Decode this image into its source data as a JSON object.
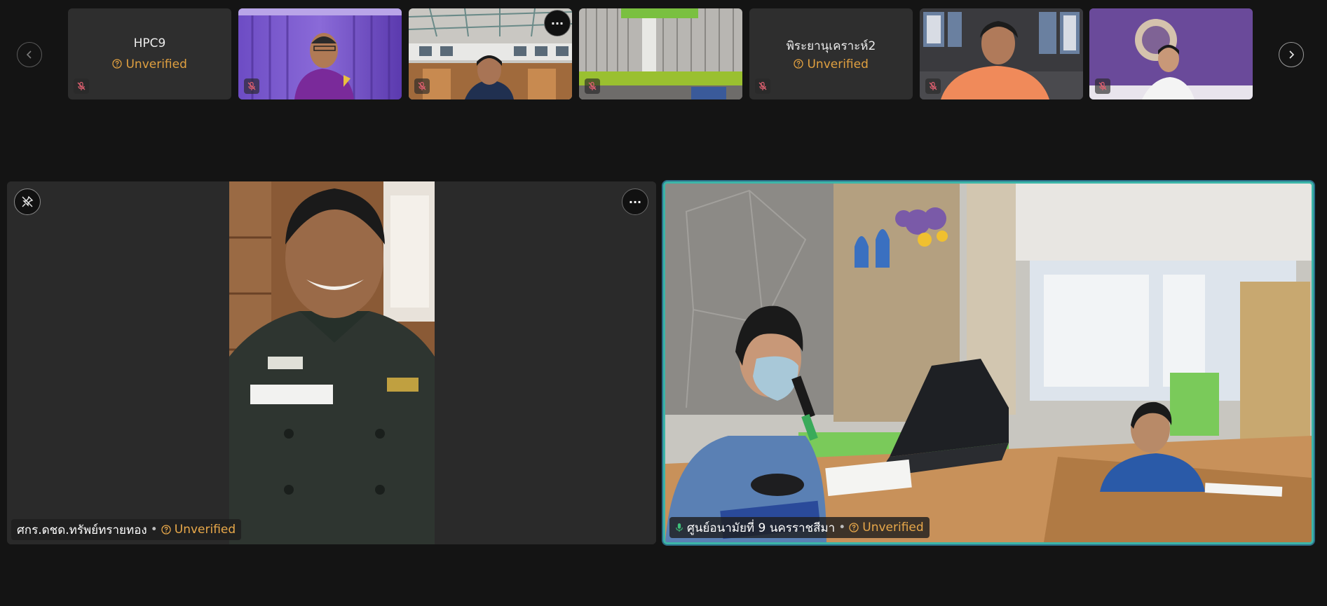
{
  "thumbnails": [
    {
      "name": "HPC9",
      "status": "Unverified"
    },
    {
      "name": "",
      "status": ""
    },
    {
      "name": "",
      "status": ""
    },
    {
      "name": "",
      "status": ""
    },
    {
      "name": "พิระยานุเคราะห์2",
      "status": "Unverified"
    },
    {
      "name": "",
      "status": ""
    },
    {
      "name": "",
      "status": ""
    }
  ],
  "main_tiles": [
    {
      "name": "ศกร.ดชด.ทรัพย์ทรายทอง",
      "separator": "•",
      "status": "Unverified"
    },
    {
      "name": "ศูนย์อนามัยที่ 9 นครราชสีมา",
      "separator": "•",
      "status": "Unverified"
    }
  ],
  "more_label": "···",
  "colors": {
    "accent_active": "#3cb5a8",
    "unverified": "#e8a84a",
    "muted_red": "#e06070",
    "speaking_green": "#3ec07a"
  }
}
